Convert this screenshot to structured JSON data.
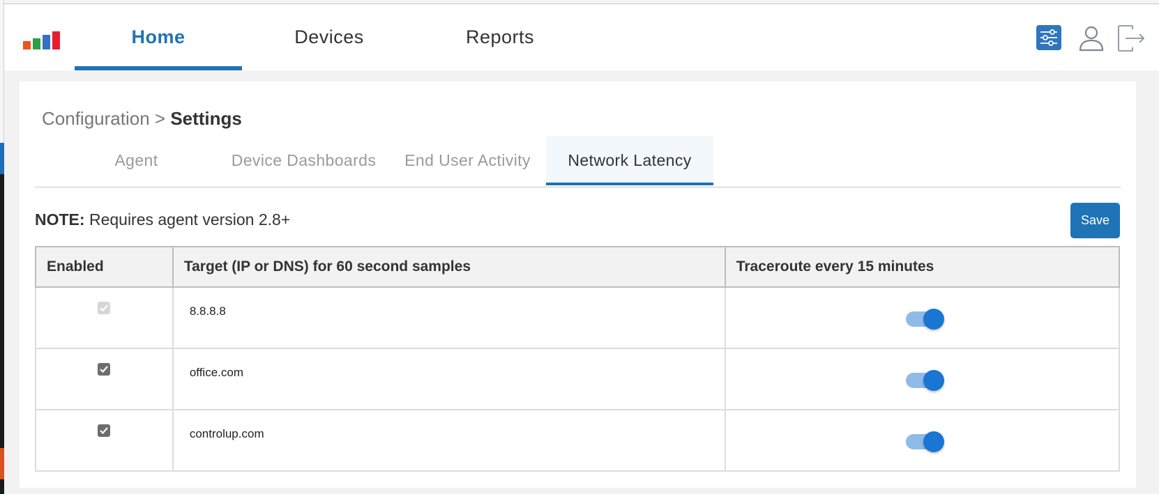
{
  "header": {
    "logo_colors": [
      "#f4511e",
      "#2ea043",
      "#3470c4",
      "#e61e2e"
    ],
    "nav": [
      {
        "label": "Home",
        "active": true
      },
      {
        "label": "Devices",
        "active": false
      },
      {
        "label": "Reports",
        "active": false
      }
    ],
    "icons": [
      "settings-sliders-icon",
      "user-icon",
      "logout-icon"
    ],
    "accent_color": "#1f73b7"
  },
  "breadcrumb": {
    "parent": "Configuration",
    "separator": ">",
    "current": "Settings"
  },
  "tabs": [
    {
      "label": "Agent",
      "active": false
    },
    {
      "label": "Device Dashboards",
      "active": false
    },
    {
      "label": "End User Activity",
      "active": false
    },
    {
      "label": "Network Latency",
      "active": true
    }
  ],
  "note": {
    "label": "NOTE:",
    "text": "Requires agent version 2.8+"
  },
  "save_label": "Save",
  "table": {
    "headers": [
      "Enabled",
      "Target (IP or DNS) for 60 second samples",
      "Traceroute every 15 minutes"
    ],
    "rows": [
      {
        "enabled": true,
        "enabled_disabled": true,
        "target": "8.8.8.8",
        "traceroute": true
      },
      {
        "enabled": true,
        "enabled_disabled": false,
        "target": "office.com",
        "traceroute": true
      },
      {
        "enabled": true,
        "enabled_disabled": false,
        "target": "controlup.com",
        "traceroute": true
      }
    ]
  }
}
